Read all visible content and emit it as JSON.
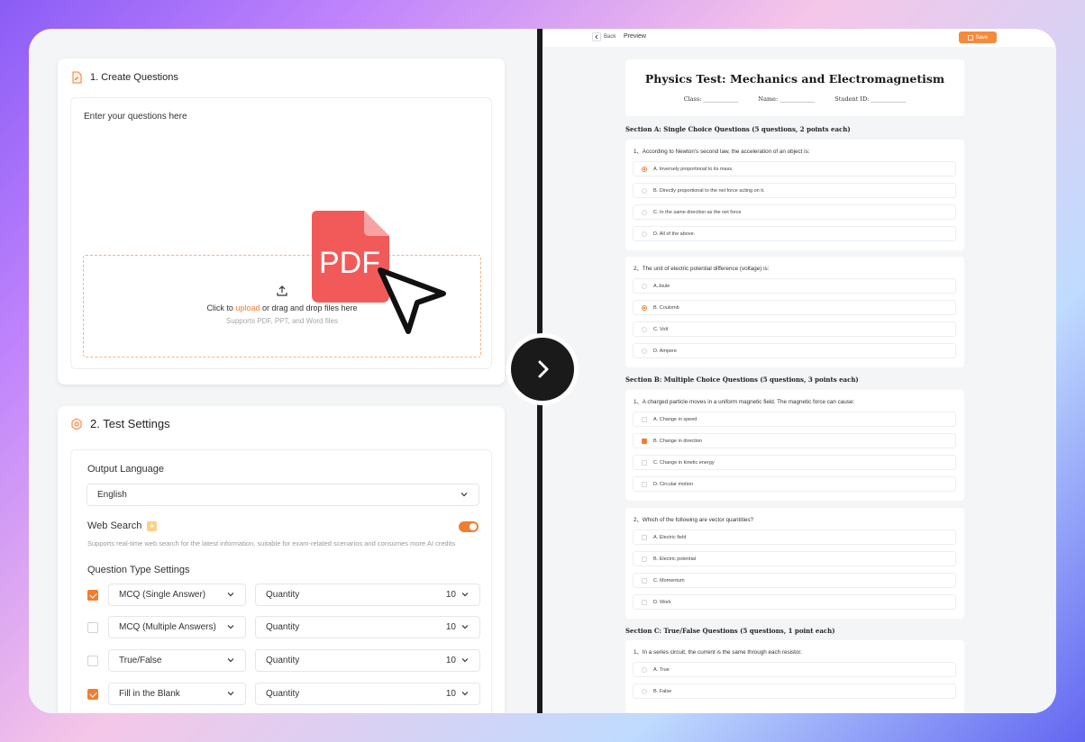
{
  "left": {
    "create": {
      "title": "1. Create Questions",
      "placeholder": "Enter your questions here",
      "upload_prefix": "Click to ",
      "upload_link": "upload",
      "upload_suffix": " or drag and drop files here",
      "upload_sub": "Supports PDF, PPT, and Word files",
      "pdf_label": "PDF"
    },
    "settings": {
      "title": "2. Test Settings",
      "output_language_label": "Output Language",
      "output_language_value": "English",
      "web_search_label": "Web Search",
      "web_search_on": true,
      "web_search_desc": "Supports real-time web search for the latest information, suitable for exam-related scenarios and consumes more AI credits",
      "question_type_label": "Question Type Settings",
      "question_types": [
        {
          "checked": true,
          "type": "MCQ (Single Answer)",
          "qty_label": "Quantity",
          "qty": "10"
        },
        {
          "checked": false,
          "type": "MCQ (Multiple Answers)",
          "qty_label": "Quantity",
          "qty": "10"
        },
        {
          "checked": false,
          "type": "True/False",
          "qty_label": "Quantity",
          "qty": "10"
        },
        {
          "checked": true,
          "type": "Fill in the Blank",
          "qty_label": "Quantity",
          "qty": "10"
        }
      ]
    }
  },
  "right": {
    "back_label": "Back",
    "preview_label": "Preview",
    "save_label": "Save",
    "paper_title": "Physics Test: Mechanics and Electromagnetism",
    "fields": {
      "class": "Class: ____________",
      "name": "Name: ____________",
      "student_id": "Student ID: ____________"
    },
    "section_a": "Section A: Single Choice Questions (5 questions, 2 points each)",
    "section_b": "Section B: Multiple Choice Questions (5 questions, 3 points each)",
    "section_c": "Section C: True/False Questions (5 questions, 1 point each)",
    "questions": [
      {
        "text": "1、According to Newton's second law, the acceleration of an object is:",
        "options": [
          "A. Inversely proportional to its mass.",
          "B. Directly proportional to the net force acting on it.",
          "C. In the same direction as the net force",
          "D. All of the above."
        ],
        "selected": 0
      },
      {
        "text": "2、The unit of electric potential difference (voltage) is:",
        "options": [
          "A.Joule",
          "B. Coulomb",
          "C. Volt",
          "D. Ampere"
        ],
        "selected": 1
      },
      {
        "text": "1、A charged particle moves in a uniform magnetic field. The magnetic force can cause:",
        "options": [
          "A. Change in speed",
          "B. Change in direction",
          "C. Change in kinetic energy",
          "D. Circular motion"
        ],
        "selected": 1
      },
      {
        "text": "2、Which of the following are vector quantities?",
        "options": [
          "A. Electric field",
          "B. Electric potential",
          "C. Momentum",
          "D. Work"
        ],
        "selected": -1
      },
      {
        "text": "1、In a series circuit, the current is the same through each resistor.",
        "options": [
          "A. True",
          "B. False"
        ],
        "selected": -1
      }
    ]
  }
}
